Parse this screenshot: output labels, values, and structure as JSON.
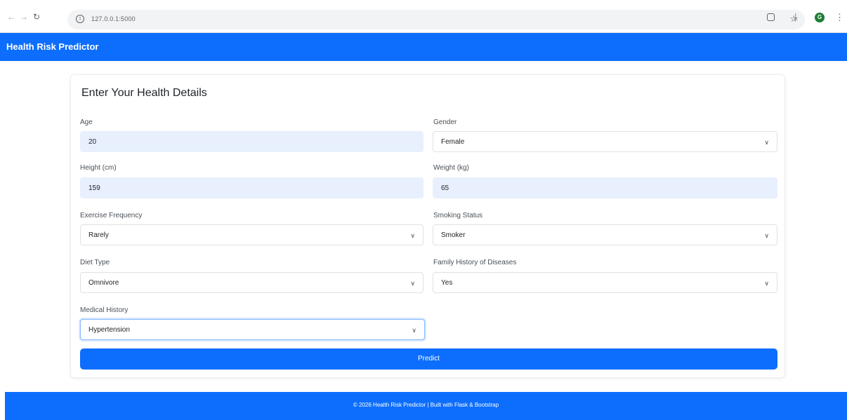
{
  "browser": {
    "url": "127.0.0.1:5000",
    "back_icon": "arrow-left-icon",
    "forward_icon": "arrow-right-icon",
    "reload_icon": "reload-icon"
  },
  "navbar": {
    "brand": "Health Risk Predictor"
  },
  "form": {
    "title": "Enter Your Health Details",
    "age": {
      "label": "Age",
      "value": "20"
    },
    "gender": {
      "label": "Gender",
      "value": "Female"
    },
    "height": {
      "label": "Height (cm)",
      "value": "159"
    },
    "weight": {
      "label": "Weight (kg)",
      "value": "65"
    },
    "exercise": {
      "label": "Exercise Frequency",
      "value": "Rarely"
    },
    "smoking": {
      "label": "Smoking Status",
      "value": "Smoker"
    },
    "diet": {
      "label": "Diet Type",
      "value": "Omnivore"
    },
    "family_history": {
      "label": "Family History of Diseases",
      "value": "Yes"
    },
    "medical_history": {
      "label": "Medical History",
      "value": "Hypertension"
    },
    "submit_label": "Predict"
  },
  "footer": {
    "text": "© 2026 Health Risk Predictor | Built with Flask & Bootstrap"
  },
  "colors": {
    "primary": "#0d6efd",
    "autofill": "#e8f0fe",
    "avatar": "#1e7e34"
  }
}
